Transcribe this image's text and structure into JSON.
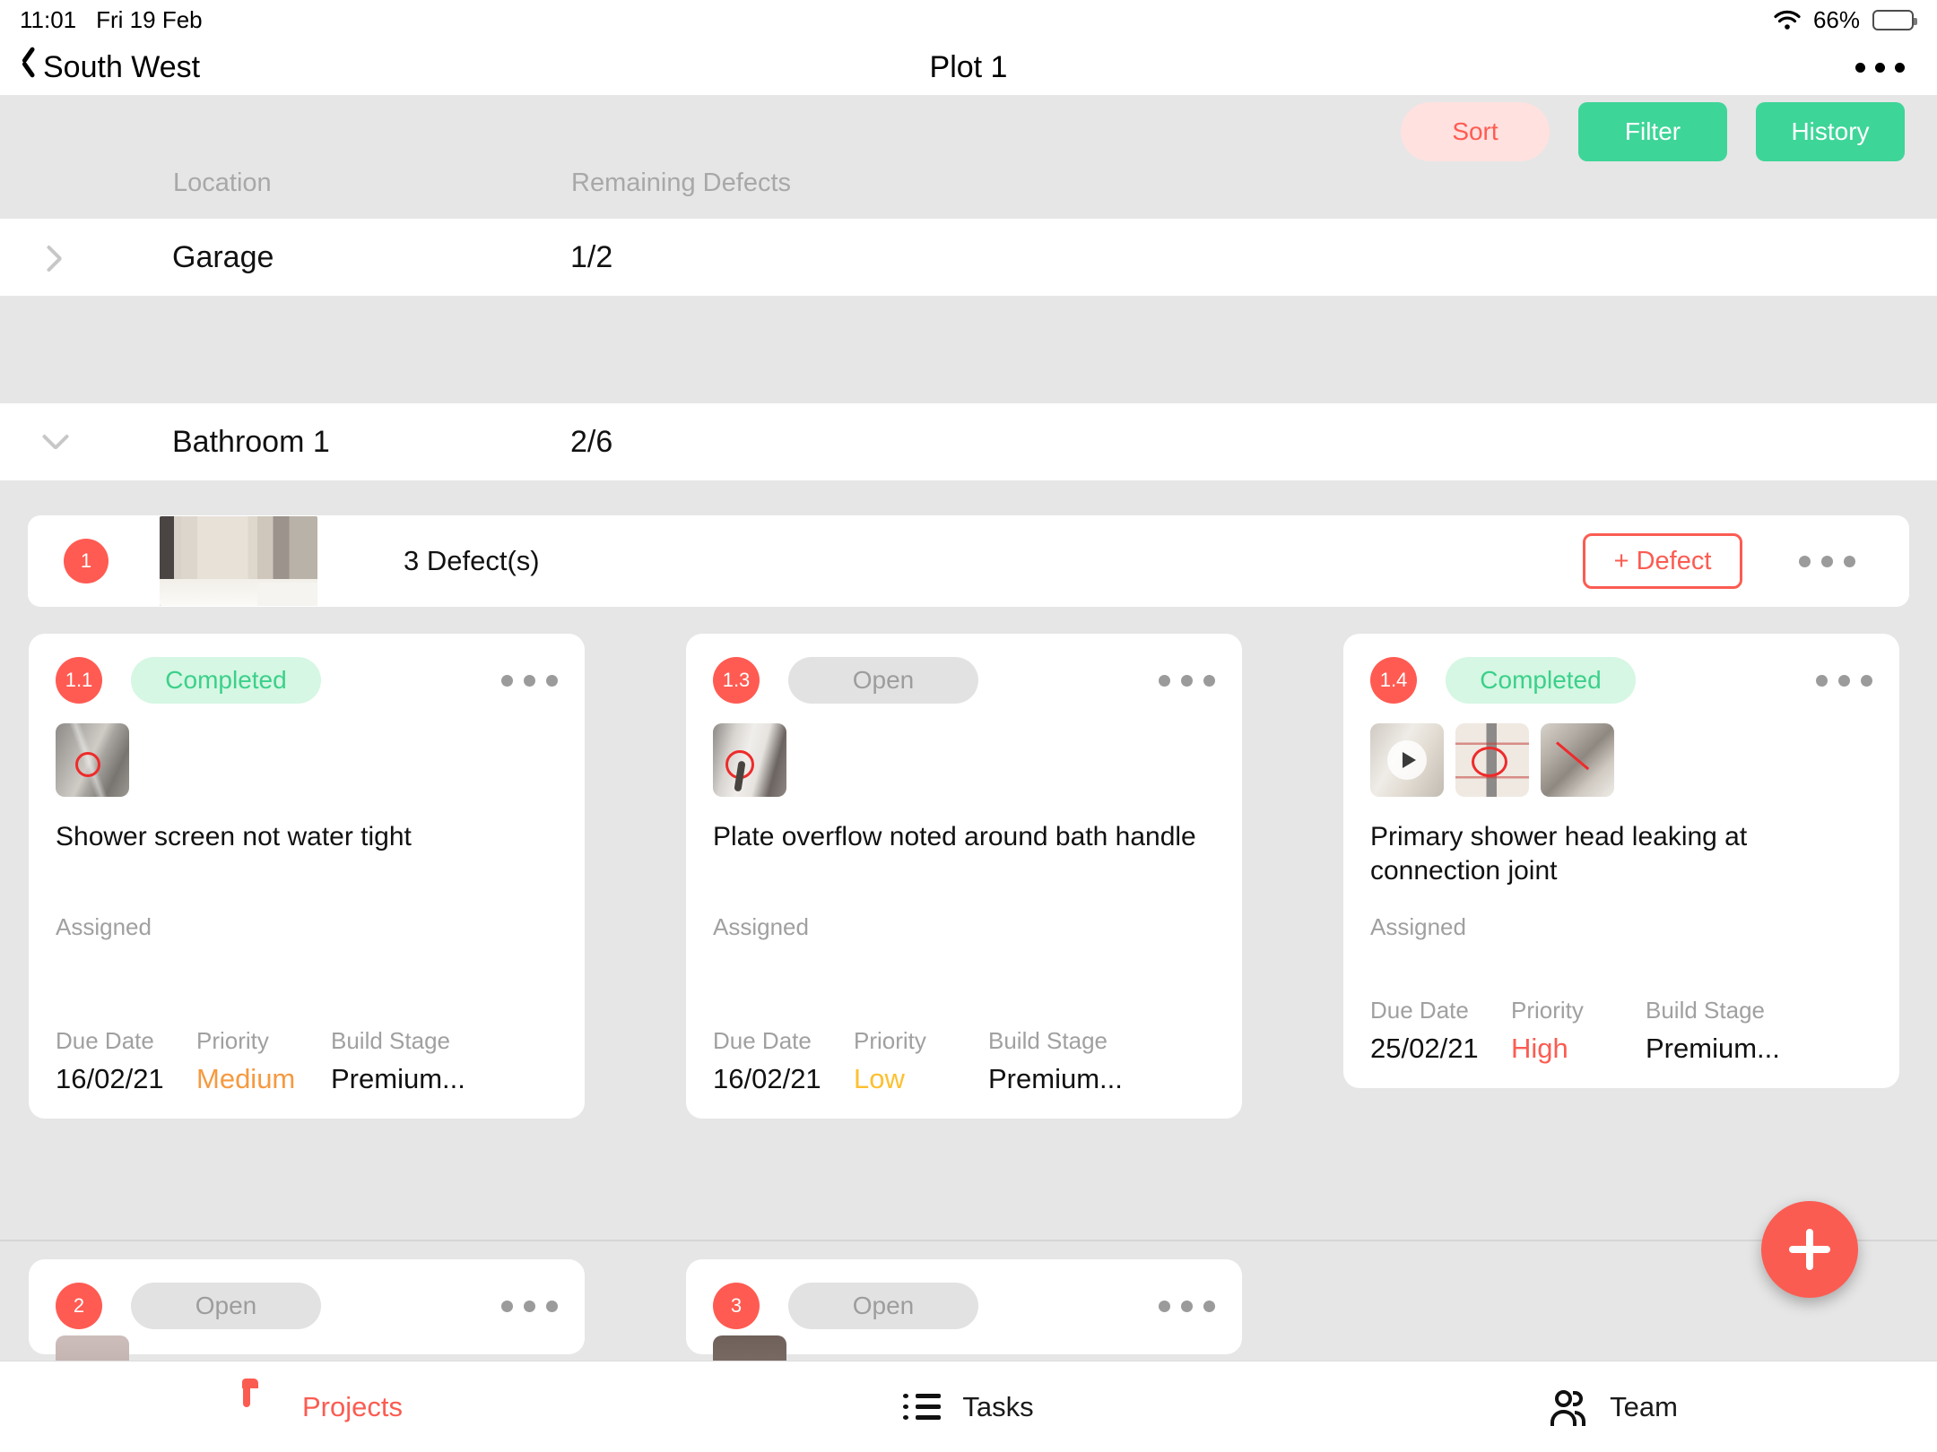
{
  "status_bar": {
    "time": "11:01",
    "date": "Fri 19 Feb",
    "battery_pct": "66%",
    "wifi_icon": "wifi-icon",
    "battery_icon": "battery-icon"
  },
  "nav": {
    "back_label": "South West",
    "title": "Plot 1",
    "more_icon": "more-horizontal-icon"
  },
  "toolbar": {
    "sort_label": "Sort",
    "filter_label": "Filter",
    "history_label": "History",
    "sort_color": "#ff5b52",
    "sort_bg": "#ffe1e0",
    "green": "#3ed598"
  },
  "columns": {
    "location": "Location",
    "remaining_defects": "Remaining Defects"
  },
  "locations": [
    {
      "name": "Garage",
      "remaining": "1/2",
      "expanded": false,
      "chevron": "chevron-right-icon"
    },
    {
      "name": "Bathroom 1",
      "remaining": "2/6",
      "expanded": true,
      "chevron": "chevron-down-icon"
    }
  ],
  "group": {
    "number": "1",
    "defects_count_label": "3 Defect(s)",
    "add_defect_label": "+ Defect",
    "more_icon": "more-horizontal-icon"
  },
  "labels": {
    "assigned": "Assigned",
    "due_date": "Due Date",
    "priority": "Priority",
    "build_stage": "Build Stage"
  },
  "defects": [
    {
      "number": "1.1",
      "status": "Completed",
      "status_type": "completed",
      "title": "Shower screen not water tight",
      "assigned": "",
      "due_date": "16/02/21",
      "priority": "Medium",
      "priority_class": "pr-medium",
      "build_stage": "Premium...",
      "photo_count": 1
    },
    {
      "number": "1.3",
      "status": "Open",
      "status_type": "open",
      "title": "Plate overflow noted around bath handle",
      "assigned": "",
      "due_date": "16/02/21",
      "priority": "Low",
      "priority_class": "pr-low",
      "build_stage": "Premium...",
      "photo_count": 1
    },
    {
      "number": "1.4",
      "status": "Completed",
      "status_type": "completed",
      "title": "Primary shower head leaking at connection joint",
      "assigned": "",
      "due_date": "25/02/21",
      "priority": "High",
      "priority_class": "pr-high",
      "build_stage": "Premium...",
      "photo_count": 3
    }
  ],
  "partial_defects": [
    {
      "number": "2",
      "status": "Open",
      "status_type": "open"
    },
    {
      "number": "3",
      "status": "Open",
      "status_type": "open"
    }
  ],
  "fab": {
    "icon": "plus-icon",
    "color": "#fb5c52"
  },
  "tabs": [
    {
      "label": "Projects",
      "icon": "folder-icon",
      "active": true
    },
    {
      "label": "Tasks",
      "icon": "list-icon",
      "active": false
    },
    {
      "label": "Team",
      "icon": "people-icon",
      "active": false
    }
  ],
  "colors": {
    "accent_red": "#fb5c52",
    "green": "#3ed598",
    "page_bg": "#e6e6e6",
    "card_bg": "#ffffff"
  }
}
